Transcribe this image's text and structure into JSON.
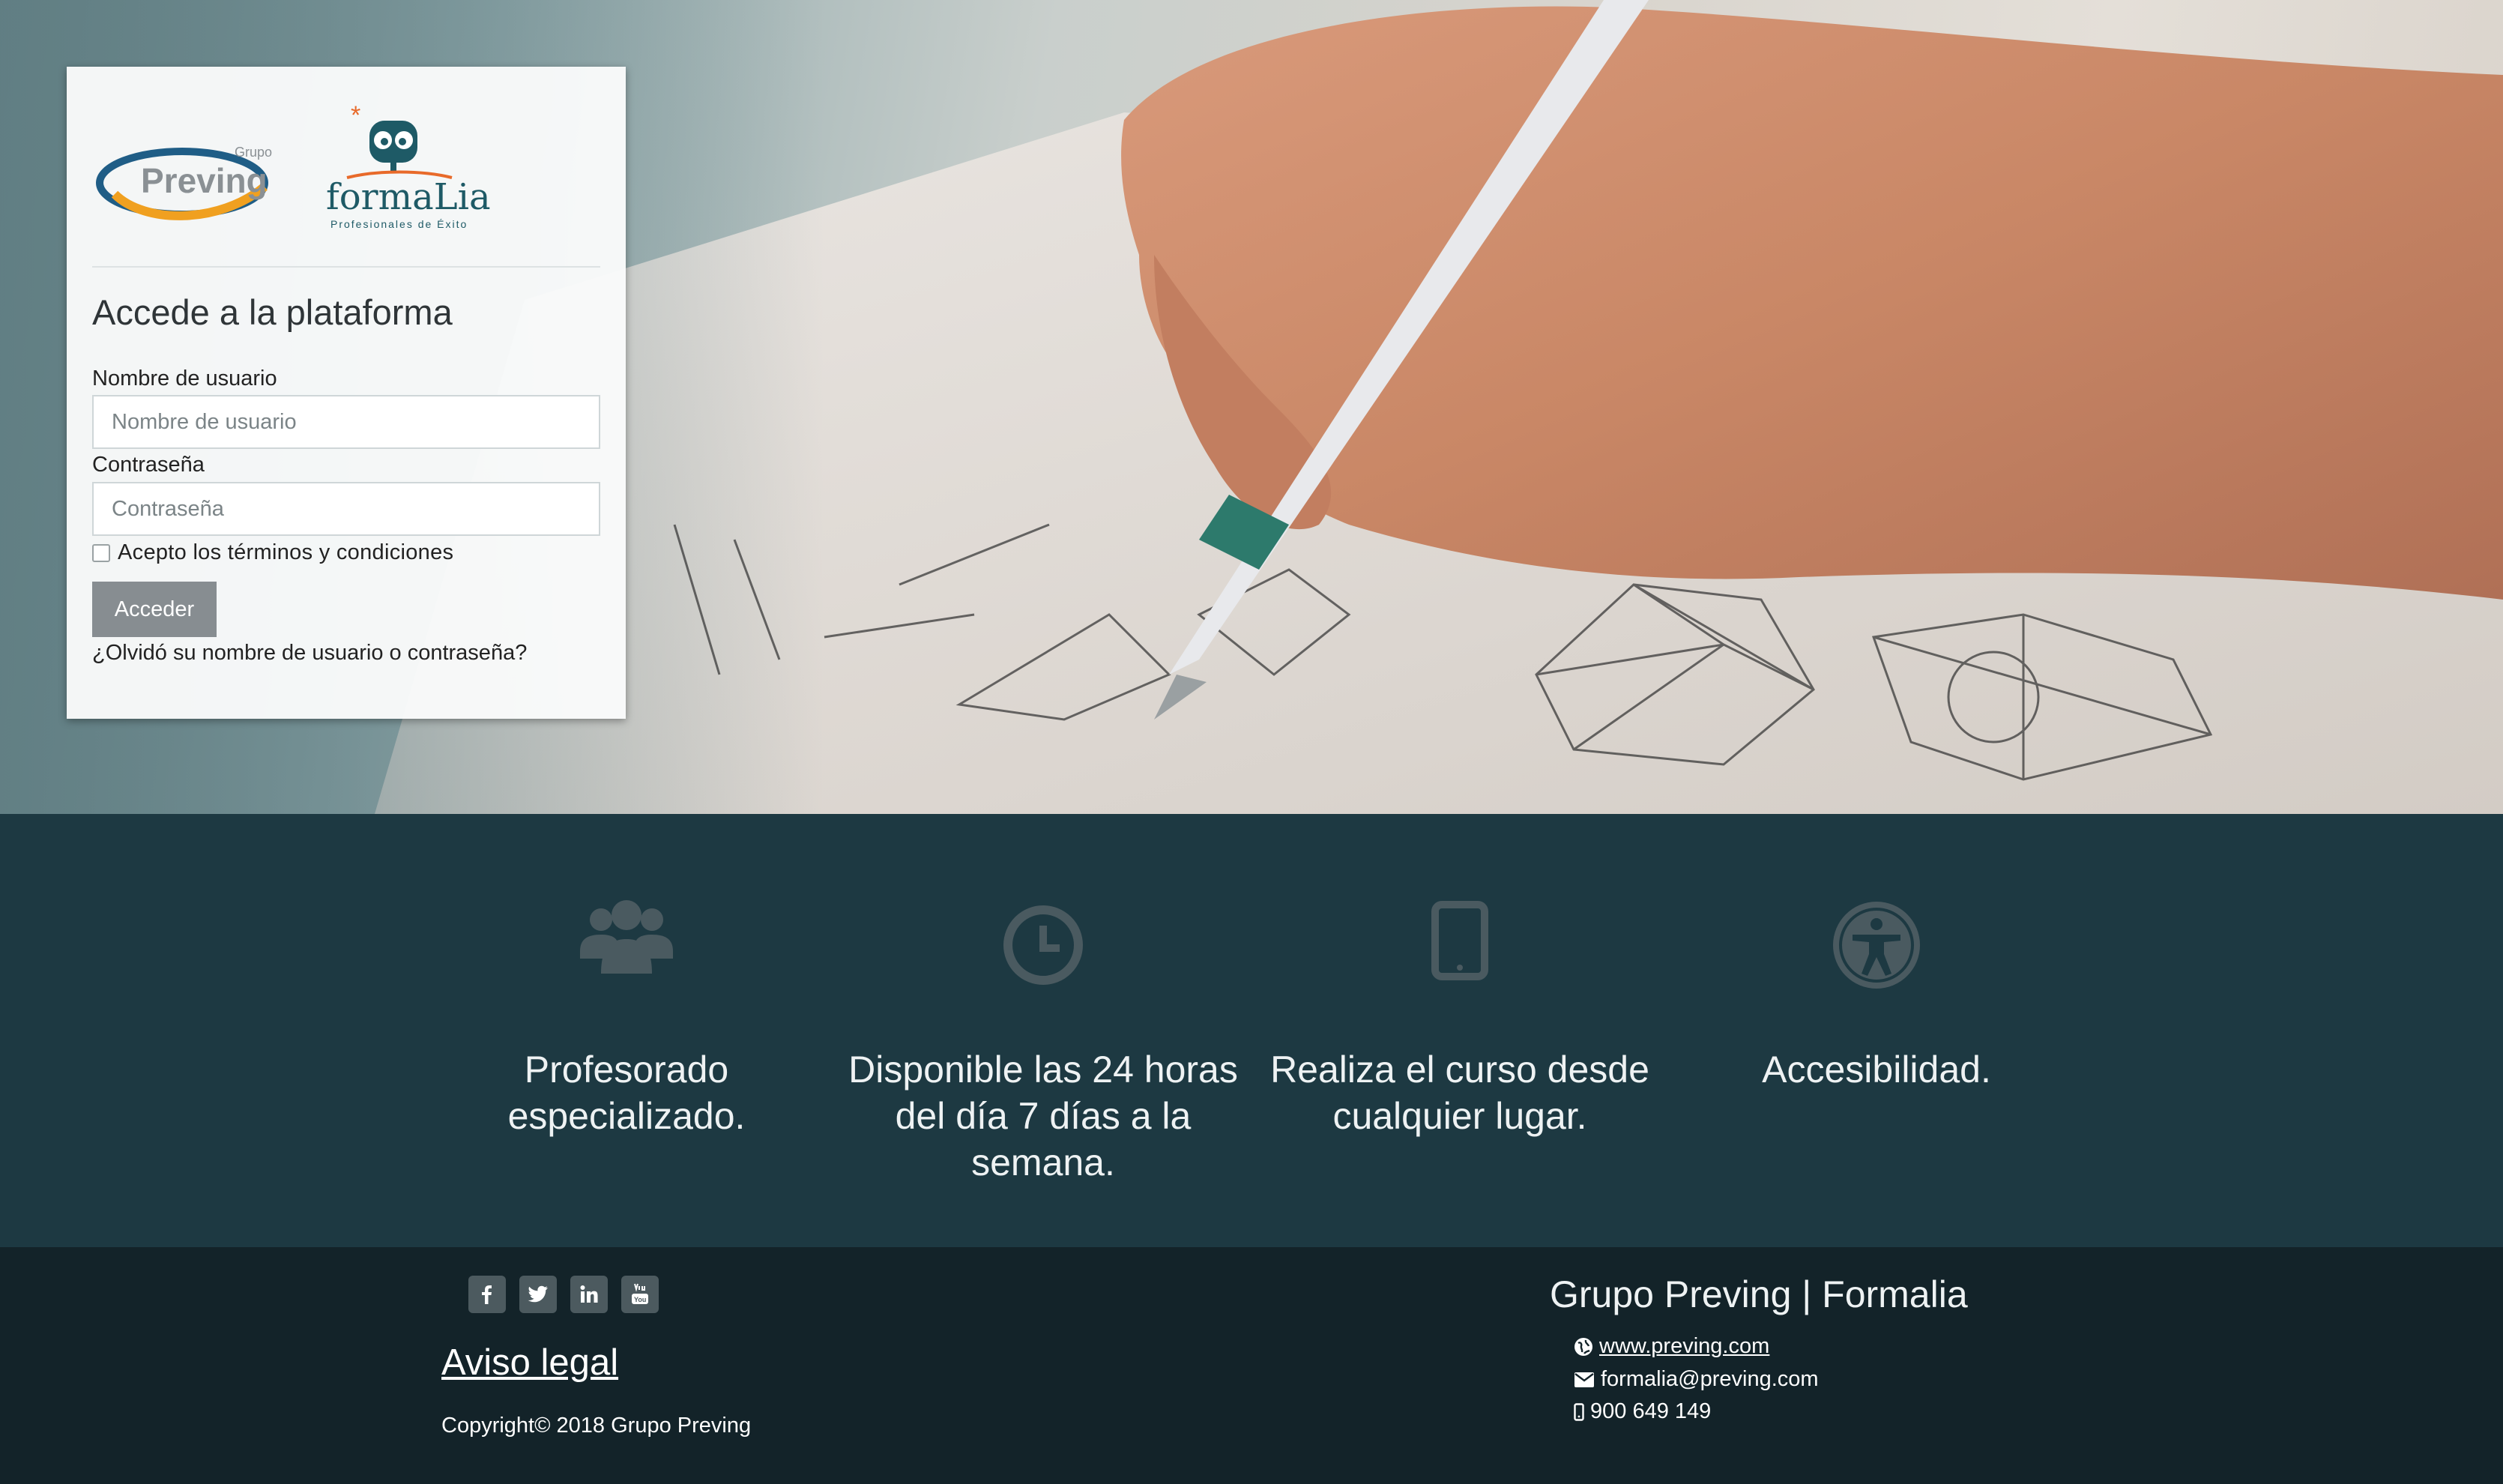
{
  "login": {
    "logo_preving_small": "Grupo",
    "logo_preving_big": "Preving",
    "logo_formalia": "formaLia",
    "logo_formalia_tagline": "Profesionales de Éxito",
    "title": "Accede a la plataforma",
    "username_label": "Nombre de usuario",
    "username_placeholder": "Nombre de usuario",
    "password_label": "Contraseña",
    "password_placeholder": "Contraseña",
    "terms_label": "Acepto los términos y condiciones",
    "submit_label": "Acceder",
    "forgot_label": "¿Olvidó su nombre de usuario o contraseña?"
  },
  "features": [
    {
      "icon": "users-icon",
      "text": "Profesorado especializado."
    },
    {
      "icon": "clock-icon",
      "text": "Disponible las 24 horas del día 7 días a la semana."
    },
    {
      "icon": "tablet-icon",
      "text": "Realiza el curso desde cualquier lugar."
    },
    {
      "icon": "accessibility-icon",
      "text": "Accesibilidad."
    }
  ],
  "footer": {
    "social_icons": [
      "facebook-icon",
      "twitter-icon",
      "linkedin-icon",
      "youtube-icon"
    ],
    "legal_label": "Aviso legal",
    "copyright": "Copyright© 2018 Grupo Preving",
    "title": "Grupo Preving | Formalia",
    "website": "www.preving.com",
    "email": "formalia@preving.com",
    "phone": "900 649 149"
  },
  "colors": {
    "features_bg": "#1d3942",
    "footer_bg": "#132329",
    "icon_color": "#4a5a60",
    "button_bg": "#878d91",
    "preving_blue": "#1f5d86",
    "preving_orange": "#f0a020",
    "formalia_teal": "#1e5a66",
    "formalia_orange": "#e86a2a"
  }
}
